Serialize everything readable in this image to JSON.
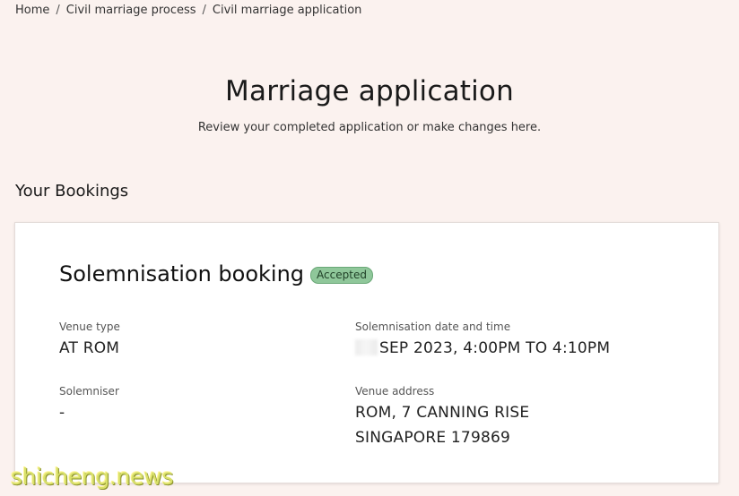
{
  "breadcrumb": {
    "items": [
      "Home",
      "Civil marriage process",
      "Civil marriage application"
    ],
    "separator": "/"
  },
  "header": {
    "title": "Marriage application",
    "subtitle": "Review your completed application or make changes here."
  },
  "bookings": {
    "heading": "Your Bookings",
    "card": {
      "title": "Solemnisation booking",
      "status": "Accepted",
      "status_color": "#8fc79a",
      "fields": {
        "venue_type": {
          "label": "Venue type",
          "value": "AT ROM"
        },
        "datetime": {
          "label": "Solemnisation date and time",
          "value": "SEP 2023, 4:00PM TO 4:10PM"
        },
        "solemniser": {
          "label": "Solemniser",
          "value": "-"
        },
        "venue_address": {
          "label": "Venue address",
          "line1": "ROM, 7 CANNING RISE",
          "line2": "SINGAPORE 179869"
        }
      }
    }
  },
  "watermark": "shicheng.news"
}
